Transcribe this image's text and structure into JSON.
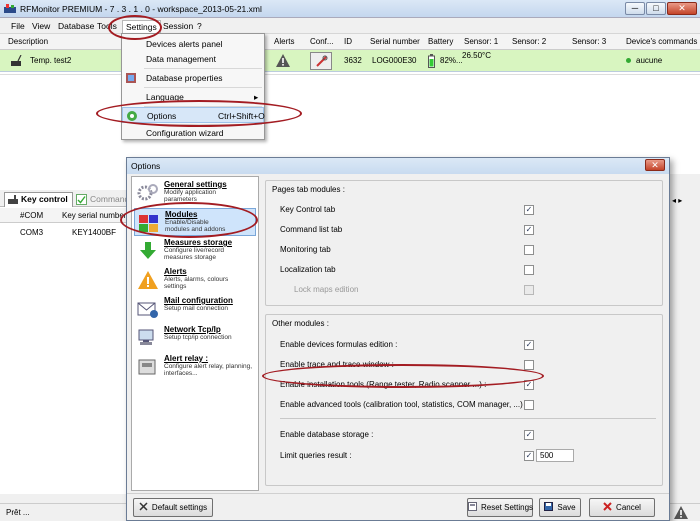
{
  "window": {
    "title": "RFMonitor PREMIUM - 7 . 3 . 1 . 0 - workspace_2013-05-21.xml",
    "min_glyph": "─",
    "max_glyph": "□",
    "close_glyph": "✕"
  },
  "menubar": {
    "items": [
      "File",
      "View",
      "Database",
      "Tools",
      "Settings",
      "Session",
      "?"
    ]
  },
  "grid": {
    "columns": [
      "Description",
      "Alerts",
      "Conf...",
      "ID",
      "Serial number",
      "Battery",
      "Sensor: 1",
      "Sensor: 2",
      "Sensor: 3",
      "Device's commands"
    ],
    "row": {
      "description": "Temp. test2",
      "id": "3632",
      "serial": "LOG000E30",
      "battery": "82%...",
      "sensor1": "26.50°C",
      "command": "aucune"
    }
  },
  "settings_menu": {
    "items": [
      {
        "label": "Devices alerts panel"
      },
      {
        "label": "Data management"
      },
      {
        "label": "Database properties"
      },
      {
        "label": "Language",
        "submenu": "▸"
      },
      {
        "label": "Options",
        "shortcut": "Ctrl+Shift+O"
      },
      {
        "label": "Configuration wizard"
      }
    ]
  },
  "lower_panel": {
    "tab_key": "Key control",
    "tab_cmd": "Command",
    "columns": [
      "#COM",
      "Key serial number"
    ],
    "row": {
      "com": "COM3",
      "serial": "KEY1400BF"
    },
    "more_glyph": "◂ ▸"
  },
  "statusbar": {
    "text": "Prêt ..."
  },
  "dialog": {
    "title": "Options",
    "close_glyph": "✕",
    "nav": [
      {
        "title": "General settings",
        "desc": "Modify application\nparameters"
      },
      {
        "title": "Modules",
        "desc": "Enable/Disable\nmodules and addons"
      },
      {
        "title": "Measures storage",
        "desc": "Configure live/record\nmeasures storage"
      },
      {
        "title": "Alerts",
        "desc": "Alerts, alarms, colours\nsettings"
      },
      {
        "title": "Mail configuration",
        "desc": "Setup mail connection"
      },
      {
        "title": "Network Tcp/Ip",
        "desc": "Setup tcp/ip connection"
      },
      {
        "title": "Alert relay :",
        "desc": "Configure alert relay, planning,\ninterfaces..."
      }
    ],
    "pages_group": {
      "title": "Pages tab modules :",
      "options": [
        {
          "label": "Key Control tab",
          "checked": true
        },
        {
          "label": "Command list tab",
          "checked": true
        },
        {
          "label": "Monitoring tab",
          "checked": false
        },
        {
          "label": "Localization tab",
          "checked": false
        },
        {
          "label": "Lock maps edition",
          "checked": false,
          "disabled": true
        }
      ]
    },
    "other_group": {
      "title": "Other modules :",
      "options": [
        {
          "label": "Enable devices formulas edition :",
          "checked": true
        },
        {
          "label": "Enable trace and trace window :",
          "checked": false
        },
        {
          "label": "Enable installation tools (Range tester, Radio scanner ...) :",
          "checked": true
        },
        {
          "label": "Enable advanced tools (calibration tool, statistics, COM manager, ...) :",
          "checked": false
        },
        {
          "label": "Enable database storage :",
          "checked": true
        },
        {
          "label": "Limit queries result :",
          "checked": true
        }
      ],
      "limit_value": "500"
    },
    "check_glyph": "✓",
    "buttons": {
      "default": "Default settings",
      "reset": "Reset Settings",
      "save": "Save",
      "cancel": "Cancel"
    }
  }
}
